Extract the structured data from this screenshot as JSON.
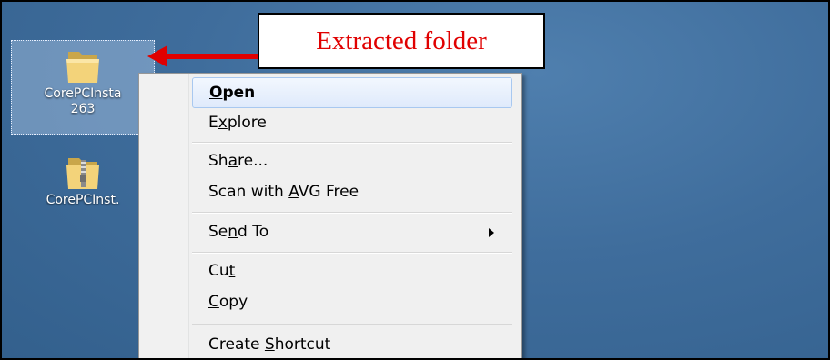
{
  "desktop": {
    "icons": [
      {
        "name": "CorePCInsta",
        "name_line2": "263",
        "type": "folder"
      },
      {
        "name": "CorePCInst.",
        "type": "zip-folder"
      }
    ]
  },
  "annotation": {
    "callout_text": "Extracted folder",
    "arrow_color": "#e00000"
  },
  "context_menu": {
    "items": [
      {
        "pre": "",
        "key": "O",
        "post": "pen",
        "bold": true
      },
      {
        "pre": "E",
        "key": "x",
        "post": "plore"
      },
      {
        "pre": "Sh",
        "key": "a",
        "post": "re..."
      },
      {
        "pre": "Scan with ",
        "key": "A",
        "post": "VG Free"
      },
      {
        "pre": "Se",
        "key": "n",
        "post": "d To",
        "submenu": true
      },
      {
        "pre": "Cu",
        "key": "t",
        "post": ""
      },
      {
        "pre": "",
        "key": "C",
        "post": "opy"
      },
      {
        "pre": "Create ",
        "key": "S",
        "post": "hortcut"
      }
    ]
  }
}
